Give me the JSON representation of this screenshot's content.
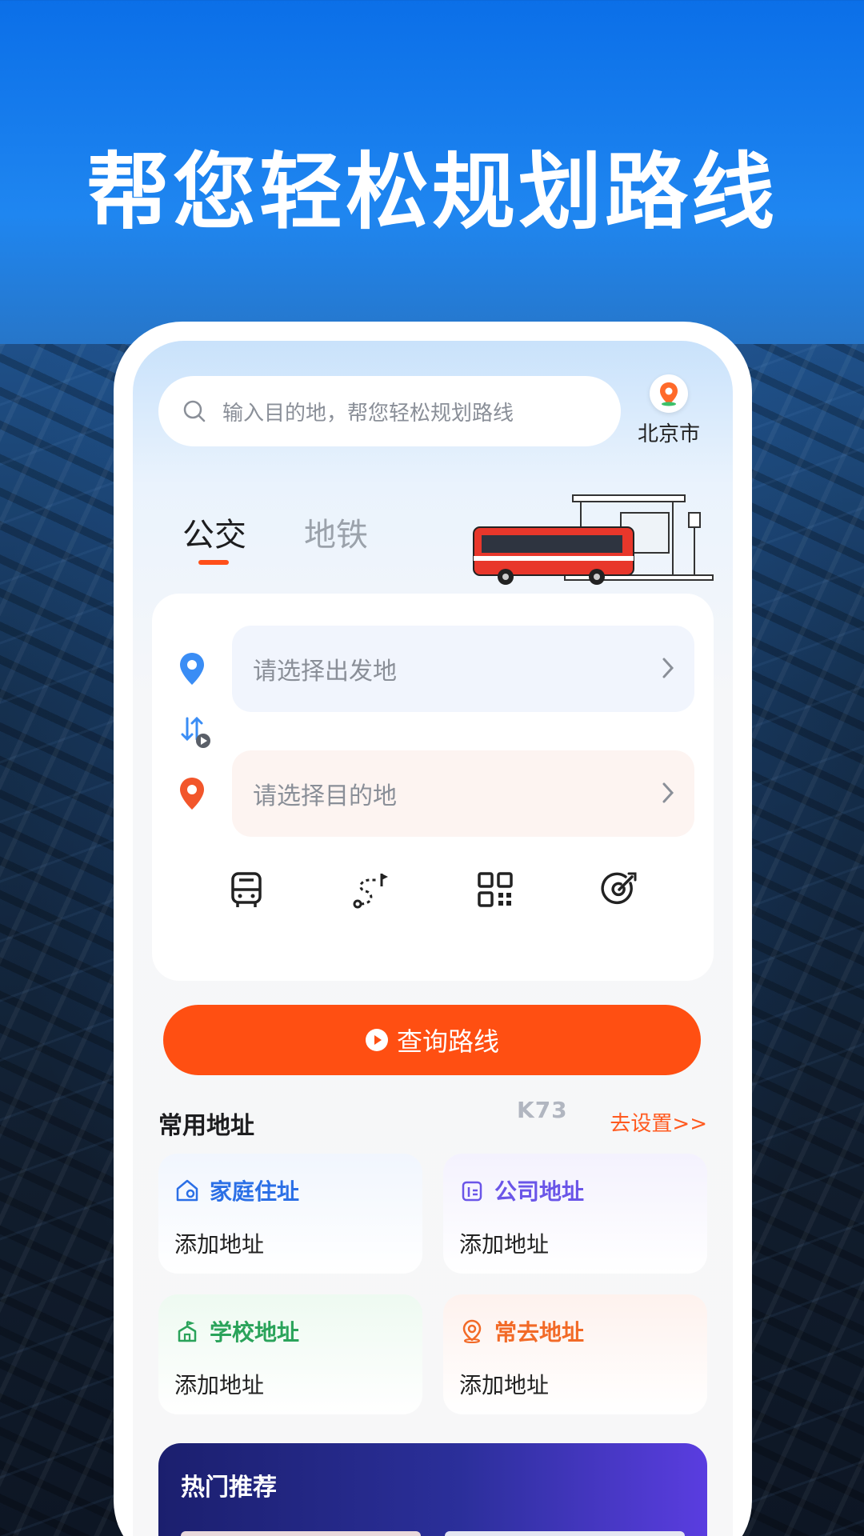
{
  "headline": "帮您轻松规划路线",
  "search": {
    "placeholder": "输入目的地，帮您轻松规划路线"
  },
  "city": {
    "name": "北京市"
  },
  "tabs": [
    {
      "label": "公交",
      "active": true
    },
    {
      "label": "地铁",
      "active": false
    }
  ],
  "route": {
    "from_placeholder": "请选择出发地",
    "to_placeholder": "请选择目的地"
  },
  "tools": [
    "bus-icon",
    "route-icon",
    "grid-icon",
    "target-icon"
  ],
  "query_button": "查询路线",
  "common_address": {
    "title": "常用地址",
    "link": "去设置>>",
    "items": [
      {
        "label": "家庭住址",
        "sub": "添加地址",
        "icon": "home-icon",
        "color": "#2b6fe6"
      },
      {
        "label": "公司地址",
        "sub": "添加地址",
        "icon": "office-icon",
        "color": "#6a55e8"
      },
      {
        "label": "学校地址",
        "sub": "添加地址",
        "icon": "school-icon",
        "color": "#2aa35a"
      },
      {
        "label": "常去地址",
        "sub": "添加地址",
        "icon": "location-icon",
        "color": "#f26a27"
      }
    ]
  },
  "hot": {
    "title": "热门推荐"
  },
  "watermark": "K73",
  "colors": {
    "accent": "#ff4f12",
    "primary_blue": "#1f86f0"
  }
}
